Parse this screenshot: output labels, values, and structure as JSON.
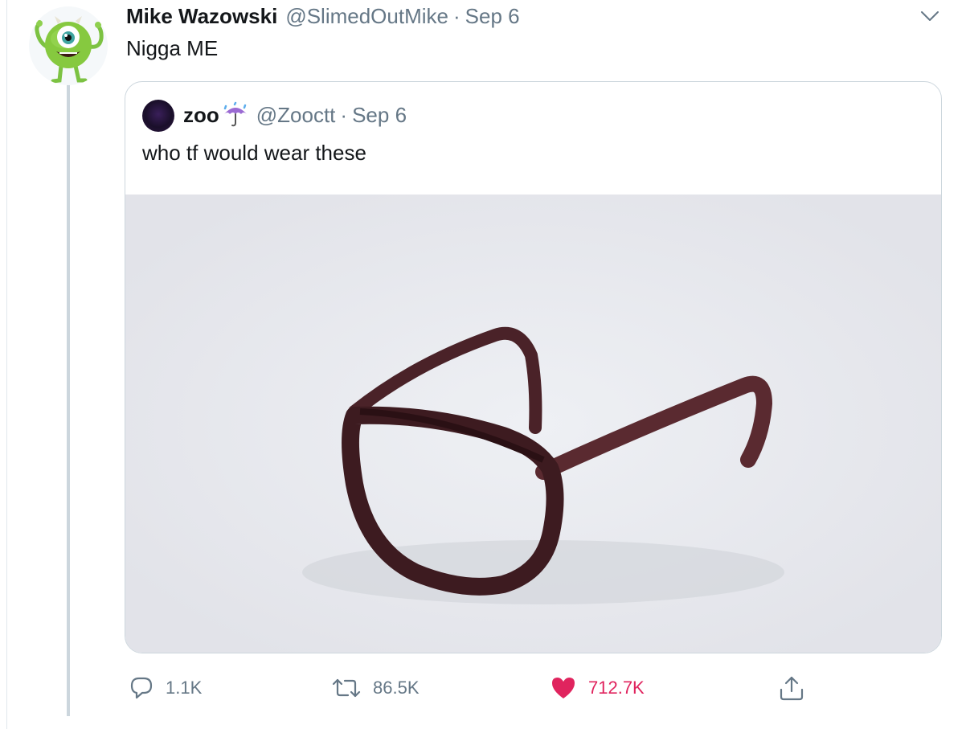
{
  "tweet": {
    "author_name": "Mike Wazowski",
    "author_handle": "@SlimedOutMike",
    "separator": "·",
    "date": "Sep 6",
    "text": "Nigga ME",
    "avatar_icon": "mike-wazowski-avatar",
    "menu_icon": "chevron-down-icon"
  },
  "quoted": {
    "author_name": "zoo",
    "author_emoji": "umbrella-with-rain-drops",
    "author_handle": "@Zooctt",
    "separator": "·",
    "date": "Sep 6",
    "text": "who tf would wear these",
    "image_subject": "eyeglasses-photo"
  },
  "actions": {
    "reply": {
      "icon": "reply-icon",
      "count": "1.1K"
    },
    "retweet": {
      "icon": "retweet-icon",
      "count": "86.5K"
    },
    "like": {
      "icon": "heart-icon",
      "count": "712.7K",
      "liked": true,
      "color": "#e0245e"
    },
    "share": {
      "icon": "share-icon"
    }
  },
  "colors": {
    "text_primary": "#14171a",
    "text_secondary": "#657786",
    "border": "#ccd6dd",
    "like": "#e0245e"
  }
}
